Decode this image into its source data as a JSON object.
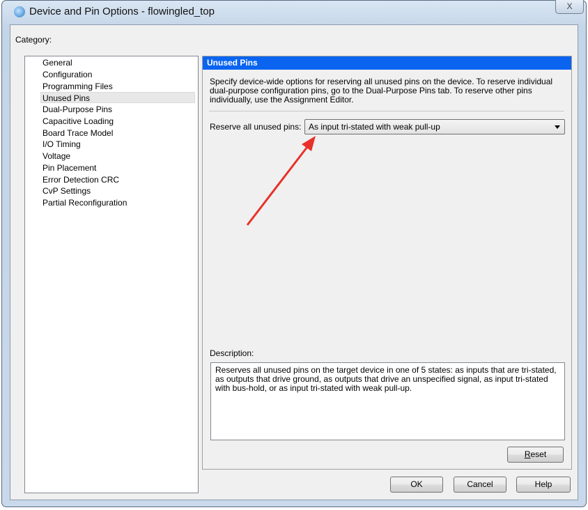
{
  "window": {
    "title": "Device and Pin Options - flowingled_top",
    "close_label": "X"
  },
  "category": {
    "label": "Category:",
    "items": [
      "General",
      "Configuration",
      "Programming Files",
      "Unused Pins",
      "Dual-Purpose Pins",
      "Capacitive Loading",
      "Board Trace Model",
      "I/O Timing",
      "Voltage",
      "Pin Placement",
      "Error Detection CRC",
      "CvP Settings",
      "Partial Reconfiguration"
    ],
    "selected": "Unused Pins"
  },
  "panel": {
    "header": "Unused Pins",
    "intro": "Specify device-wide options for reserving all unused pins on the device. To reserve individual dual-purpose configuration pins, go to the Dual-Purpose Pins tab. To reserve other pins individually, use the Assignment Editor.",
    "reserve_label": "Reserve all unused pins:",
    "reserve_value": "As input tri-stated with weak pull-up",
    "description_label": "Description:",
    "description": "Reserves all unused pins on the target device in one of 5 states: as inputs that are tri-stated, as outputs that drive ground, as outputs that drive an unspecified signal, as input tri-stated with bus-hold, or as input tri-stated with weak pull-up.",
    "reset_label": "Reset"
  },
  "buttons": {
    "ok": "OK",
    "cancel": "Cancel",
    "help": "Help"
  },
  "annotation": {
    "arrow_color": "#e8312a"
  },
  "colors": {
    "header_bg": "#0a64f0"
  }
}
